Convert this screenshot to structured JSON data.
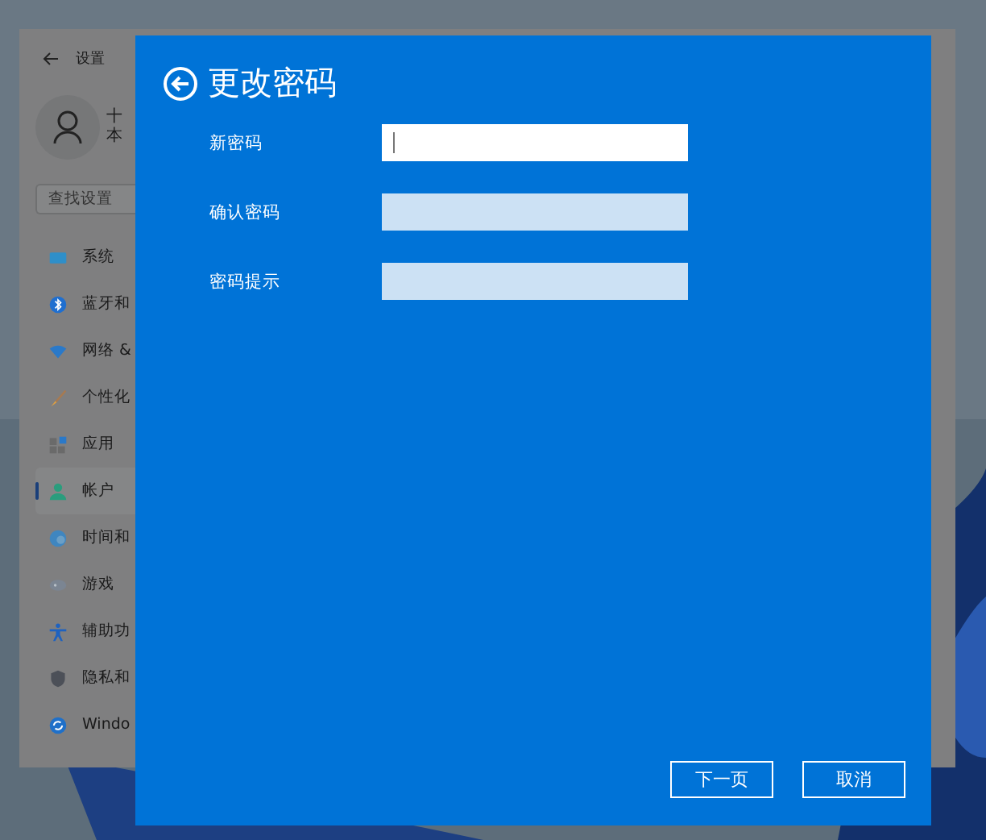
{
  "settings_window": {
    "title": "设置",
    "account": {
      "name": "十",
      "subtitle": "本"
    },
    "search": {
      "placeholder": "查找设置"
    },
    "nav_items": [
      {
        "label": "系统",
        "selected": false
      },
      {
        "label": "蓝牙和",
        "selected": false
      },
      {
        "label": "网络 &",
        "selected": false
      },
      {
        "label": "个性化",
        "selected": false
      },
      {
        "label": "应用",
        "selected": false
      },
      {
        "label": "帐户",
        "selected": true
      },
      {
        "label": "时间和",
        "selected": false
      },
      {
        "label": "游戏",
        "selected": false
      },
      {
        "label": "辅助功",
        "selected": false
      },
      {
        "label": "隐私和",
        "selected": false
      },
      {
        "label": "Windo",
        "selected": false
      }
    ]
  },
  "dialog": {
    "title": "更改密码",
    "fields": [
      {
        "label": "新密码",
        "focused": true
      },
      {
        "label": "确认密码",
        "focused": false
      },
      {
        "label": "密码提示",
        "focused": false
      }
    ],
    "buttons": [
      "下一页",
      "取消"
    ]
  }
}
